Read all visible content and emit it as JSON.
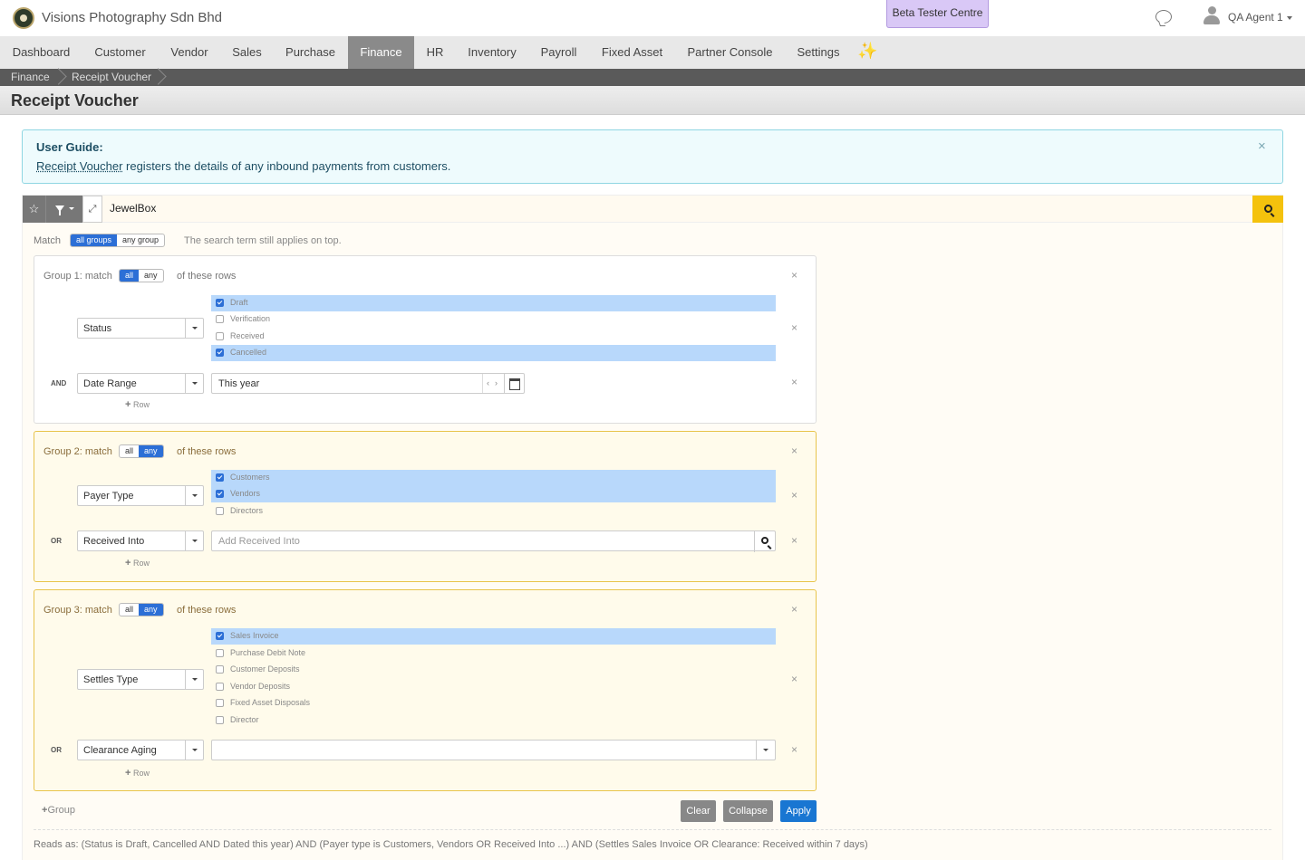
{
  "app": {
    "company": "Visions Photography Sdn Bhd",
    "beta_label": "Beta Tester Centre",
    "user": "QA Agent 1"
  },
  "nav": [
    "Dashboard",
    "Customer",
    "Vendor",
    "Sales",
    "Purchase",
    "Finance",
    "HR",
    "Inventory",
    "Payroll",
    "Fixed Asset",
    "Partner Console",
    "Settings"
  ],
  "nav_active": "Finance",
  "breadcrumb": [
    "Finance",
    "Receipt Voucher"
  ],
  "page_title": "Receipt Voucher",
  "guide": {
    "title": "User Guide:",
    "link": "Receipt Voucher",
    "text": " registers the details of any inbound payments from customers.",
    "close": "×"
  },
  "search": {
    "value": "JewelBox"
  },
  "match": {
    "label": "Match",
    "options": [
      "all groups",
      "any group"
    ],
    "selected": "all groups",
    "hint": "The search term still applies on top."
  },
  "groups": [
    {
      "label": "Group 1: match",
      "options": [
        "all",
        "any"
      ],
      "selected": "all",
      "suffix": "of these rows",
      "rows": [
        {
          "field": "Status",
          "checks": [
            {
              "label": "Draft",
              "checked": true
            },
            {
              "label": "Verification",
              "checked": false
            },
            {
              "label": "Received",
              "checked": false
            },
            {
              "label": "Cancelled",
              "checked": true
            }
          ]
        },
        {
          "connector": "AND",
          "field": "Date Range",
          "value": "This year"
        }
      ],
      "add_row": "Row"
    },
    {
      "label": "Group 2: match",
      "options": [
        "all",
        "any"
      ],
      "selected": "any",
      "suffix": "of these rows",
      "rows": [
        {
          "field": "Payer Type",
          "checks": [
            {
              "label": "Customers",
              "checked": true
            },
            {
              "label": "Vendors",
              "checked": true
            },
            {
              "label": "Directors",
              "checked": false
            }
          ]
        },
        {
          "connector": "OR",
          "field": "Received Into",
          "placeholder": "Add Received Into"
        }
      ],
      "add_row": "Row"
    },
    {
      "label": "Group 3: match",
      "options": [
        "all",
        "any"
      ],
      "selected": "any",
      "suffix": "of these rows",
      "rows": [
        {
          "field": "Settles Type",
          "checks": [
            {
              "label": "Sales Invoice",
              "checked": true
            },
            {
              "label": "Purchase Debit Note",
              "checked": false
            },
            {
              "label": "Customer Deposits",
              "checked": false
            },
            {
              "label": "Vendor Deposits",
              "checked": false
            },
            {
              "label": "Fixed Asset Disposals",
              "checked": false
            },
            {
              "label": "Director",
              "checked": false
            }
          ]
        },
        {
          "connector": "OR",
          "field": "Clearance Aging",
          "value": ""
        }
      ],
      "add_row": "Row"
    }
  ],
  "actions": {
    "add_group": "Group",
    "clear": "Clear",
    "collapse": "Collapse",
    "apply": "Apply"
  },
  "reads_as": "Reads as: (Status is Draft, Cancelled AND Dated this year) AND (Payer type is Customers, Vendors OR Received Into ...) AND (Settles Sales Invoice OR Clearance: Received within 7 days)",
  "colors": {
    "accent": "#2c6fd6",
    "search_go": "#f4c20d",
    "nav_active": "#8a8a8a",
    "beta": "#d9c8f6"
  }
}
